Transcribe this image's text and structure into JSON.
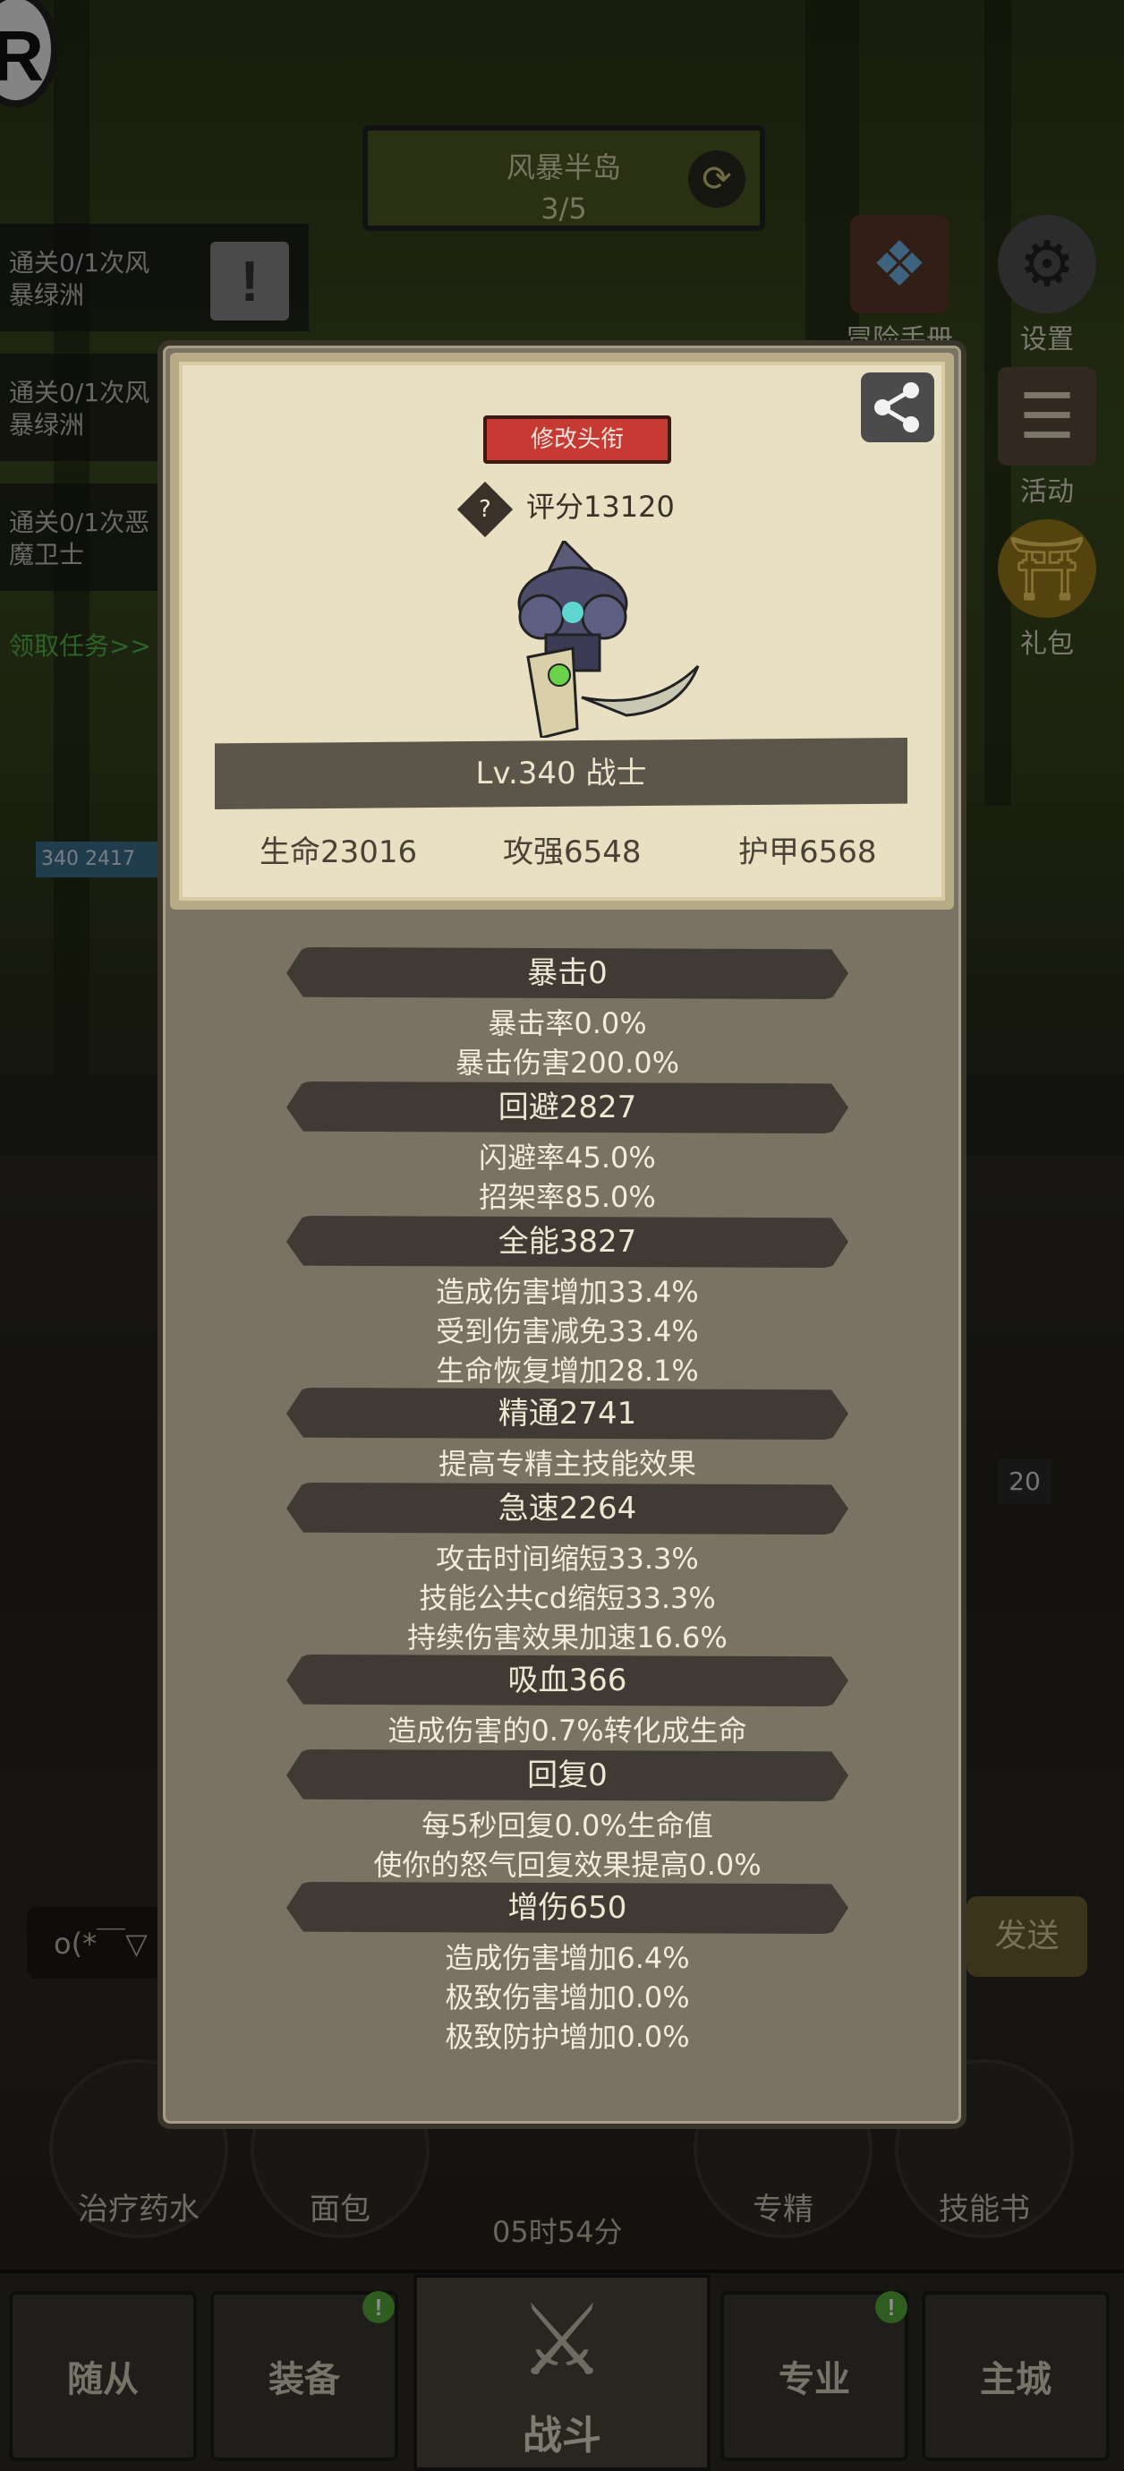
{
  "background": {
    "map": {
      "name": "风暴半岛",
      "progress": "3/5"
    },
    "quests": [
      {
        "line1": "通关0/1次风",
        "line2": "暴绿洲"
      },
      {
        "line1": "通关0/1次风",
        "line2": "暴绿洲"
      },
      {
        "line1": "通关0/1次恶",
        "line2": "魔卫士"
      }
    ],
    "get_task": "领取任务>>",
    "side_menu": [
      {
        "label": "冒险手册"
      },
      {
        "label": "设置"
      },
      {
        "label": "活动"
      },
      {
        "label": "礼包"
      }
    ],
    "chat_placeholder": "o(*￣▽",
    "send_label": "发送",
    "bottom_items": [
      {
        "label": "治疗药水"
      },
      {
        "label": "面包"
      },
      {
        "label": "专精"
      },
      {
        "label": "技能书"
      }
    ],
    "timer": "05时54分",
    "nav": {
      "followers": "随从",
      "equipment": "装备",
      "fight": "战斗",
      "profession": "专业",
      "city": "主城"
    },
    "badge_count": "20",
    "player_level_small": "340",
    "player_hp_small": "2417"
  },
  "profile": {
    "title_button": "修改头衔",
    "score": "评分13120",
    "level_class": "Lv.340 战士",
    "stats": {
      "hp": "生命23016",
      "attack": "攻强6548",
      "armor": "护甲6568"
    }
  },
  "attributes": [
    {
      "header": "暴击0",
      "lines": [
        "暴击率0.0%",
        "暴击伤害200.0%"
      ]
    },
    {
      "header": "回避2827",
      "lines": [
        "闪避率45.0%",
        "招架率85.0%"
      ]
    },
    {
      "header": "全能3827",
      "lines": [
        "造成伤害增加33.4%",
        "受到伤害减免33.4%",
        "生命恢复增加28.1%"
      ]
    },
    {
      "header": "精通2741",
      "lines": [
        "提高专精主技能效果"
      ]
    },
    {
      "header": "急速2264",
      "lines": [
        "攻击时间缩短33.3%",
        "技能公共cd缩短33.3%",
        "持续伤害效果加速16.6%"
      ]
    },
    {
      "header": "吸血366",
      "lines": [
        "造成伤害的0.7%转化成生命"
      ]
    },
    {
      "header": "回复0",
      "lines": [
        "每5秒回复0.0%生命值",
        "使你的怒气回复效果提高0.0%"
      ]
    },
    {
      "header": "增伤650",
      "lines": [
        "造成伤害增加6.4%",
        "极致伤害增加0.0%",
        "极致防护增加0.0%"
      ]
    }
  ],
  "colors": {
    "title_badge": "#c63a33",
    "card_bg": "#e9dfc2",
    "modal_bg": "#7a7363",
    "header_bg": "#3f3a33",
    "quest_green": "#4fb54a"
  }
}
